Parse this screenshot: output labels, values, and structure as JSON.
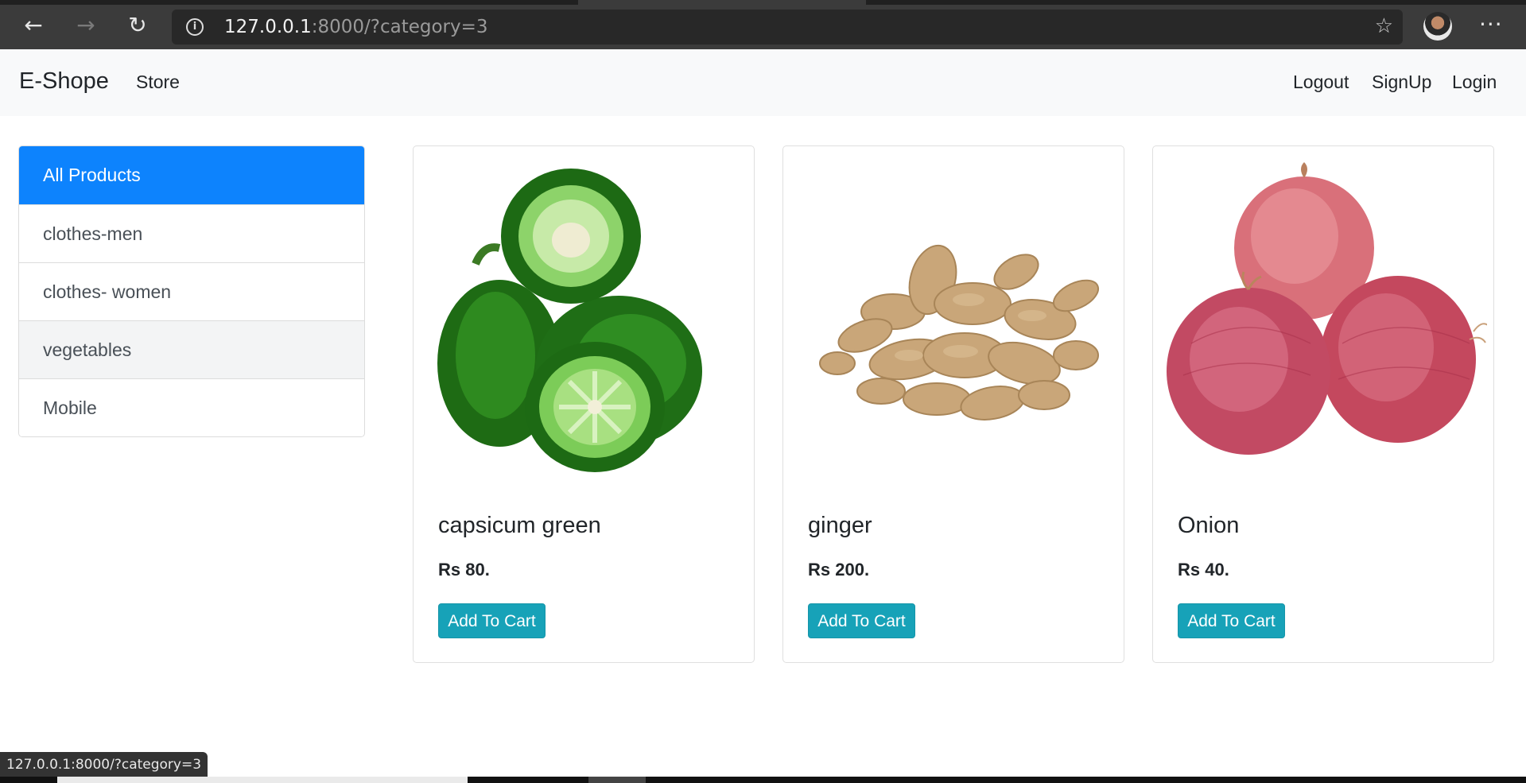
{
  "browser": {
    "back_icon": "←",
    "forward_icon": "→",
    "reload_icon": "↻",
    "url_host": "127.0.0.1",
    "url_rest": ":8000/?category=3",
    "star_icon": "☆",
    "more_icon": "···"
  },
  "navbar": {
    "brand": "E-Shope",
    "store": "Store",
    "logout": "Logout",
    "signup": "SignUp",
    "login": "Login"
  },
  "sidebar": {
    "items": [
      {
        "label": "All Products"
      },
      {
        "label": "clothes-men"
      },
      {
        "label": "clothes- women"
      },
      {
        "label": "vegetables"
      },
      {
        "label": "Mobile"
      }
    ]
  },
  "products": [
    {
      "name": "capsicum green",
      "price": "Rs 80.",
      "button": "Add To Cart"
    },
    {
      "name": "ginger",
      "price": "Rs 200.",
      "button": "Add To Cart"
    },
    {
      "name": "Onion",
      "price": "Rs 40.",
      "button": "Add To Cart"
    }
  ],
  "status_url": "127.0.0.1:8000/?category=3",
  "colors": {
    "primary": "#0d83fd",
    "button": "#17a2b8"
  }
}
